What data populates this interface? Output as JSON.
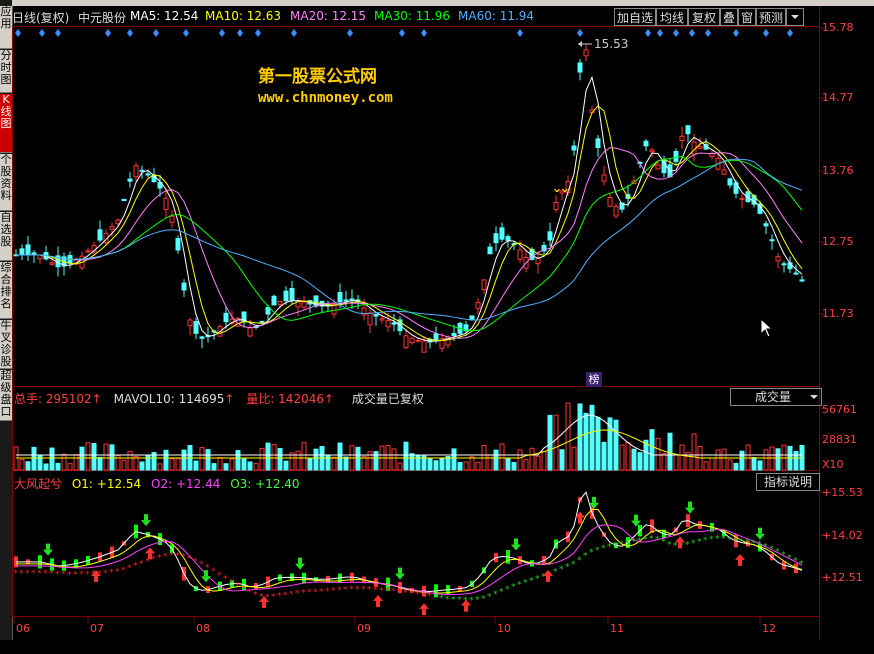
{
  "sidebar": {
    "tabs": [
      {
        "label": "应用",
        "active": false
      },
      {
        "label": "分时图",
        "active": false
      },
      {
        "label": "K线图",
        "active": true
      },
      {
        "label": "个股资料",
        "active": false
      },
      {
        "label": "自选股",
        "active": false
      },
      {
        "label": "综合排名",
        "active": false
      },
      {
        "label": "牛叉诊股",
        "active": false
      },
      {
        "label": "超级盘口",
        "active": false
      }
    ]
  },
  "header": {
    "period": "日线(复权)",
    "stock_name": "中元股份",
    "ma5": "MA5: 12.54",
    "ma10": "MA10: 12.63",
    "ma20": "MA20: 12.15",
    "ma30": "MA30: 11.96",
    "ma60": "MA60: 11.94",
    "buttons": [
      "加自选",
      "均线",
      "复权",
      "叠",
      "窗",
      "预测"
    ]
  },
  "watermark": {
    "site_name": "第一股票公式网",
    "url": "www.chnmoney.com"
  },
  "price_panel": {
    "high_marker": "15.53",
    "badge": "榜",
    "axis_ticks": [
      "15.78",
      "14.77",
      "13.76",
      "12.75",
      "11.73"
    ]
  },
  "volume_panel": {
    "total_volume": "总手: 295102",
    "mavol10": "MAVOL10: 114695",
    "volume_ratio": "量比: 142046",
    "note": "成交量已复权",
    "selector_label": "成交量",
    "axis_ticks": [
      "56761",
      "28831"
    ],
    "unit": "X10"
  },
  "indicator_panel": {
    "name": "大风起兮",
    "o1": "O1: +12.54",
    "o2": "O2: +12.44",
    "o3": "O3: +12.40",
    "help_button": "指标说明",
    "axis_ticks": [
      "+15.53",
      "+14.02",
      "+12.51"
    ]
  },
  "xaxis": {
    "months": [
      "06",
      "07",
      "08",
      "09",
      "10",
      "11",
      "12"
    ]
  },
  "colors": {
    "up": "#ff3333",
    "down": "#54ffff",
    "frame": "#800000",
    "ma5": "#ffffff",
    "ma10": "#ffff00",
    "ma20": "#ff80ff",
    "ma30": "#00ff00",
    "ma60": "#4fb0ff"
  }
}
